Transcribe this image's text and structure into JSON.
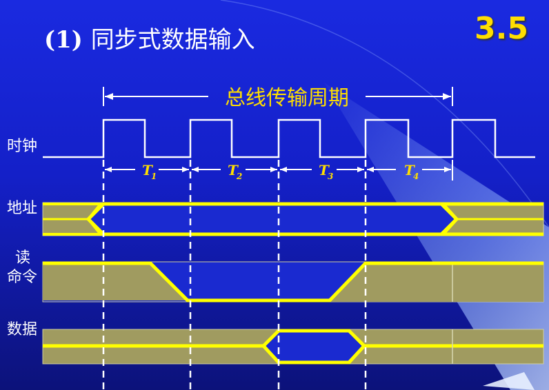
{
  "title_prefix": "(1)",
  "title_text": "同步式数据输入",
  "section_number": "3.5",
  "bus_cycle_label": "总线传输周期",
  "t_labels": [
    {
      "letter": "T",
      "sub": "1"
    },
    {
      "letter": "T",
      "sub": "2"
    },
    {
      "letter": "T",
      "sub": "3"
    },
    {
      "letter": "T",
      "sub": "4"
    }
  ],
  "signals": {
    "clock": "时钟",
    "address": "地址",
    "read_line1": "读",
    "read_line2": "命令",
    "data": "数据"
  },
  "colors": {
    "waveform": "#ffff00",
    "fill": "#a09b60",
    "cycle_label": "#ffde00",
    "section_number": "#ffde00",
    "text": "#ffffff"
  }
}
